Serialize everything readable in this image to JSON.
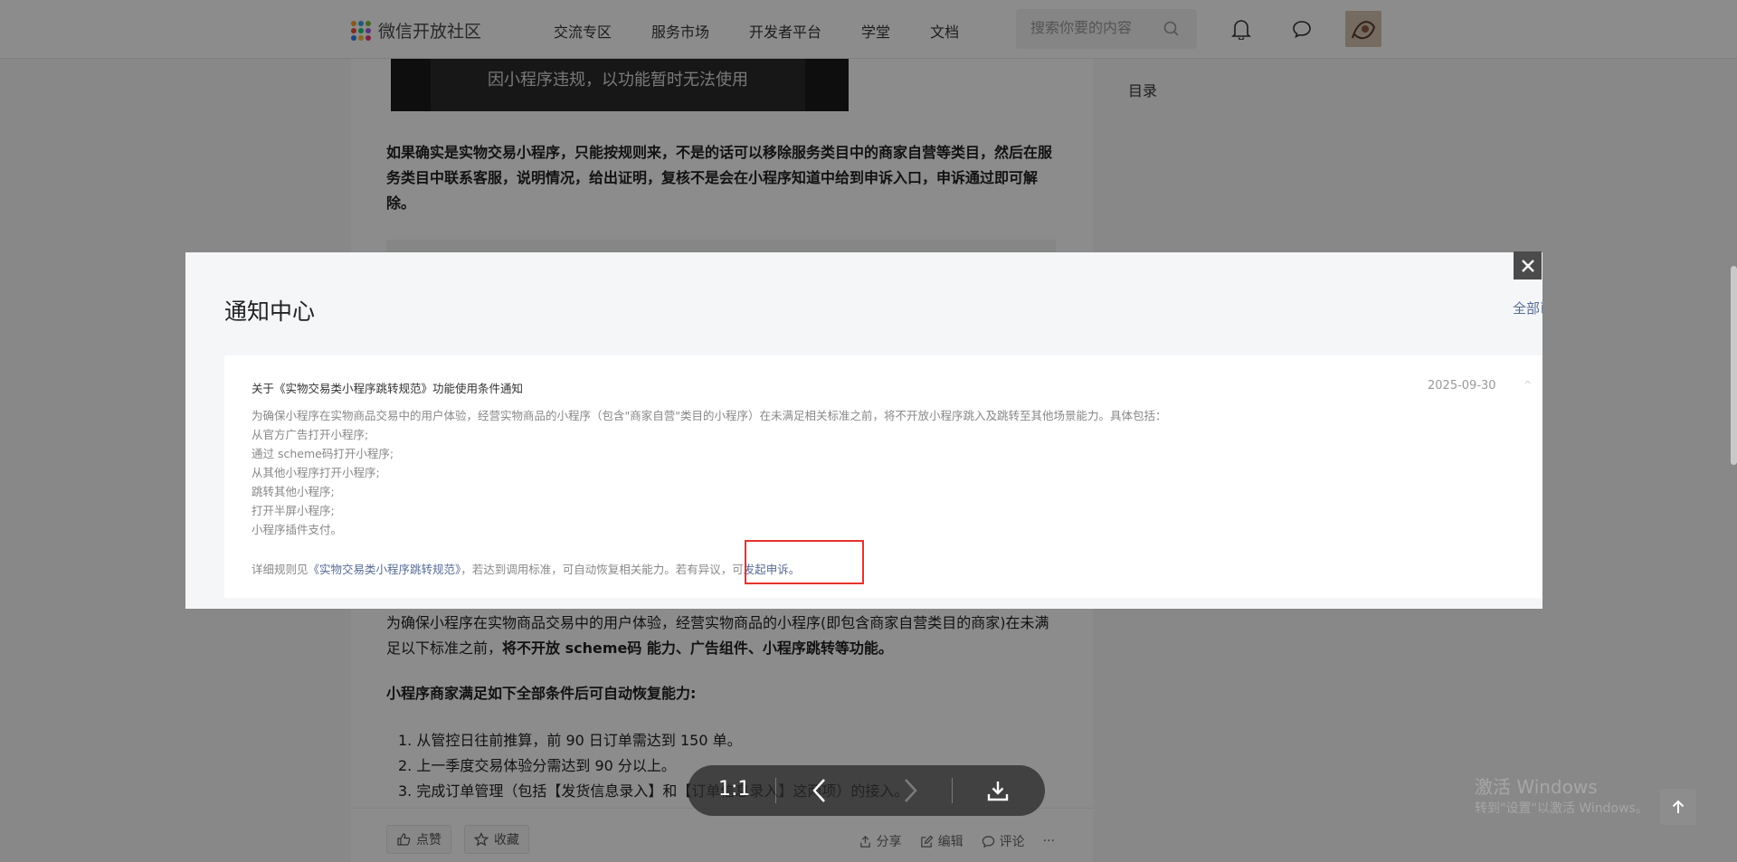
{
  "header": {
    "logo_text": "微信开放社区",
    "nav": [
      "交流专区",
      "服务市场",
      "开发者平台",
      "学堂",
      "文档"
    ],
    "search_placeholder": "搜索你要的内容"
  },
  "article": {
    "image_caption": "因小程序违规，以功能暂时无法使用",
    "para1": "如果确实是实物交易小程序，只能按规则来，不是的话可以移除服务类目中的商家自营等类目，然后在服务类目中联系客服，说明情况，给出证明，复核不是会在小程序知道中给到申诉入口，申诉通过即可解除。",
    "para2_normal": "为确保小程序在实物商品交易中的用户体验，经营实物商品的小程序(即包含商家自营类目的商家)在未满足以下标准之前，",
    "para2_bold": "将不开放 scheme码 能力、广告组件、小程序跳转等功能。",
    "para3": "小程序商家满足如下全部条件后可自动恢复能力:",
    "list": [
      "1. 从管控日往前推算，前 90 日订单需达到 150 单。",
      "2. 上一季度交易体验分需达到 90 分以上。",
      "3. 完成订单管理（包括【发货信息录入】和【订单信息录入】这两项）的接入。"
    ],
    "footer": {
      "like": "点赞",
      "favorite": "收藏",
      "share": "分享",
      "edit": "编辑",
      "comment": "评论",
      "more": "···"
    }
  },
  "toc": {
    "label": "目录"
  },
  "modal": {
    "title": "通知中心",
    "all_read": "全部已读",
    "notice": {
      "title": "关于《实物交易类小程序跳转规范》功能使用条件通知",
      "date": "2025-09-30",
      "intro": "为确保小程序在实物商品交易中的用户体验，经营实物商品的小程序（包含\"商家自营\"类目的小程序）在未满足相关标准之前，将不开放小程序跳入及跳转至其他场景能力。具体包括：",
      "items": [
        "从官方广告打开小程序;",
        "通过 scheme码打开小程序;",
        "从其他小程序打开小程序;",
        "跳转其他小程序;",
        "打开半屏小程序;",
        "小程序插件支付。"
      ],
      "foot_prefix": "详细规则见",
      "foot_link": "《实物交易类小程序跳转规范》",
      "foot_mid": "，若达到调用标准，可自动恢复相关能力。若有异议，可",
      "foot_appeal": "发起申诉。"
    }
  },
  "viewer": {
    "ratio_label": "1:1"
  },
  "watermark": {
    "line1": "激活 Windows",
    "line2": "转到\"设置\"以激活 Windows。"
  },
  "colors": {
    "link": "#576b95",
    "highlight": "#e8322e",
    "overlay": "rgba(0,0,0,0.45)"
  }
}
